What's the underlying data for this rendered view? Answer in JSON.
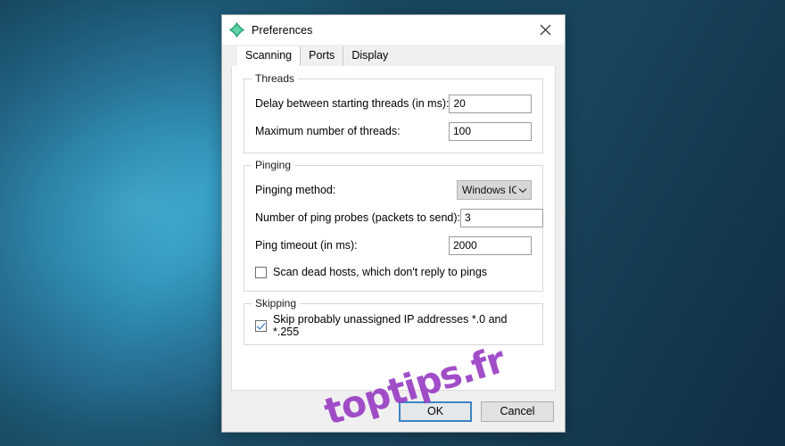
{
  "desktop": {
    "bg_center": "#49bde4",
    "bg_edge": "#153b54"
  },
  "dialog": {
    "title": "Preferences",
    "app_icon": "angry-ip-scanner-icon",
    "close_icon": "close-icon"
  },
  "tabs": [
    {
      "label": "Scanning",
      "active": true
    },
    {
      "label": "Ports",
      "active": false
    },
    {
      "label": "Display",
      "active": false
    }
  ],
  "groups": {
    "threads": {
      "legend": "Threads",
      "rows": [
        {
          "label": "Delay between starting threads (in ms):",
          "value": "20"
        },
        {
          "label": "Maximum number of threads:",
          "value": "100"
        }
      ]
    },
    "pinging": {
      "legend": "Pinging",
      "method_label": "Pinging method:",
      "method_value": "Windows ICMP",
      "method_arrow": "chevron-down-icon",
      "rows": [
        {
          "label": "Number of ping probes (packets to send):",
          "value": "3"
        },
        {
          "label": "Ping timeout (in ms):",
          "value": "2000"
        }
      ],
      "checkbox": {
        "label": "Scan dead hosts, which don't reply to pings",
        "checked": false
      }
    },
    "skipping": {
      "legend": "Skipping",
      "checkbox": {
        "label": "Skip probably unassigned IP addresses *.0 and *.255",
        "checked": true
      }
    }
  },
  "footer": {
    "ok_label": "OK",
    "cancel_label": "Cancel",
    "accent": "#3b85c4"
  },
  "watermark": {
    "text": "toptips.fr",
    "color": "#9a3fc4"
  }
}
